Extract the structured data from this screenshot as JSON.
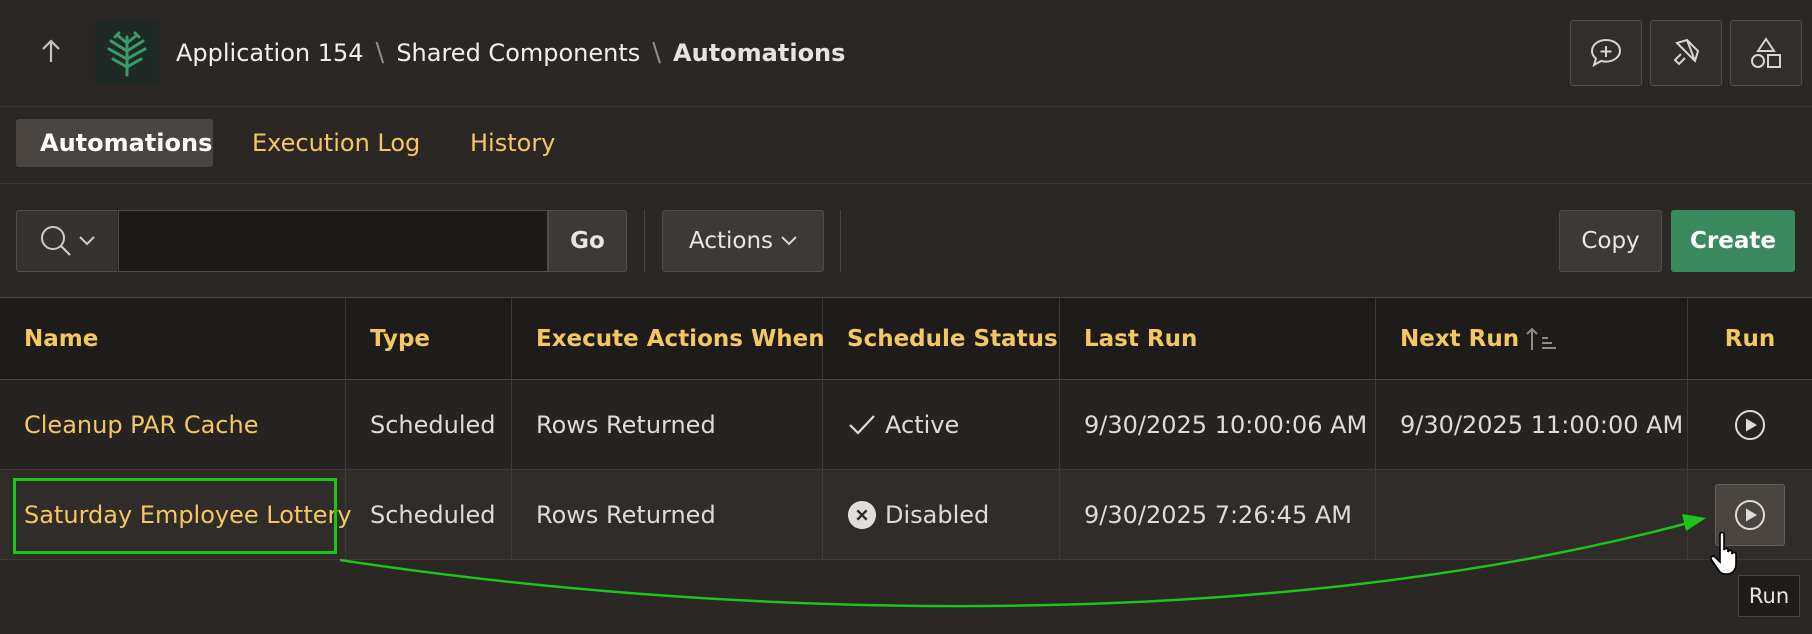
{
  "header": {
    "breadcrumbs": [
      "Application 154",
      "Shared Components",
      "Automations"
    ],
    "separator": "\\"
  },
  "tabs": [
    {
      "label": "Automations",
      "active": true
    },
    {
      "label": "Execution Log",
      "active": false
    },
    {
      "label": "History",
      "active": false
    }
  ],
  "toolbar": {
    "search_value": "",
    "go_label": "Go",
    "actions_label": "Actions",
    "copy_label": "Copy",
    "create_label": "Create"
  },
  "table": {
    "columns": [
      "Name",
      "Type",
      "Execute Actions When",
      "Schedule Status",
      "Last Run",
      "Next Run",
      "Run"
    ],
    "rows": [
      {
        "name": "Cleanup PAR Cache",
        "type": "Scheduled",
        "execute_when": "Rows Returned",
        "status": "Active",
        "last_run": "9/30/2025 10:00:06 AM",
        "next_run": "9/30/2025 11:00:00 AM"
      },
      {
        "name": "Saturday Employee Lottery",
        "type": "Scheduled",
        "execute_when": "Rows Returned",
        "status": "Disabled",
        "last_run": "9/30/2025 7:26:45 AM",
        "next_run": ""
      }
    ]
  },
  "tooltip": "Run",
  "colors": {
    "accent": "#f4c762",
    "create": "#3b8a5e",
    "highlight": "#19c619"
  }
}
